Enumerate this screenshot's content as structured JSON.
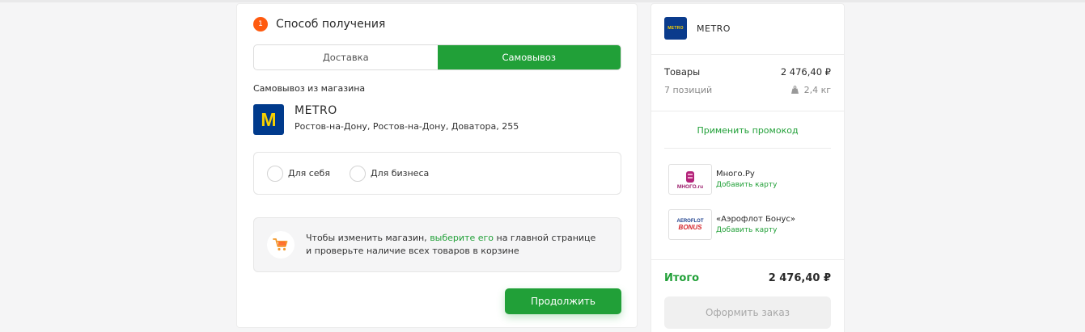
{
  "step": {
    "number": "1",
    "title": "Способ получения"
  },
  "tabs": [
    {
      "label": "Доставка",
      "active": false
    },
    {
      "label": "Самовывоз",
      "active": true
    }
  ],
  "pickup": {
    "label": "Самовывоз из магазина",
    "store_name": "METRO",
    "store_logo_letter": "M",
    "store_address": "Ростов-на-Дону, Ростов-на-Дону, Доватора, 255"
  },
  "buyer_type": {
    "options": [
      {
        "label": "Для себя",
        "selected": false
      },
      {
        "label": "Для бизнеса",
        "selected": false
      }
    ]
  },
  "info": {
    "text_before": "Чтобы изменить магазин, ",
    "link_text": "выберите его",
    "text_after": " на главной странице",
    "line2": "и проверьте наличие всех товаров в корзине",
    "icon": "shopping-cart-icon"
  },
  "continue_label": "Продолжить",
  "summary": {
    "store_name": "METRO",
    "logo_text": "METRO",
    "goods_label": "Товары",
    "goods_value": "2 476,40 ₽",
    "positions": "7 позиций",
    "weight": "2,4 кг",
    "promo_label": "Применить промокод",
    "loyalty": [
      {
        "name": "Много.Ру",
        "action": "Добавить карту",
        "logo_text": "МНОГО.ru"
      },
      {
        "name": "«Аэрофлот Бонус»",
        "action": "Добавить карту",
        "logo_line1": "AEROFLOT",
        "logo_line2": "BONUS"
      }
    ],
    "total_label": "Итого",
    "total_value": "2 476,40 ₽",
    "checkout_label": "Оформить заказ"
  },
  "colors": {
    "accent_green": "#21a038",
    "step_orange": "#ff5a0f",
    "metro_blue": "#003a8c",
    "metro_yellow": "#f9d100"
  }
}
